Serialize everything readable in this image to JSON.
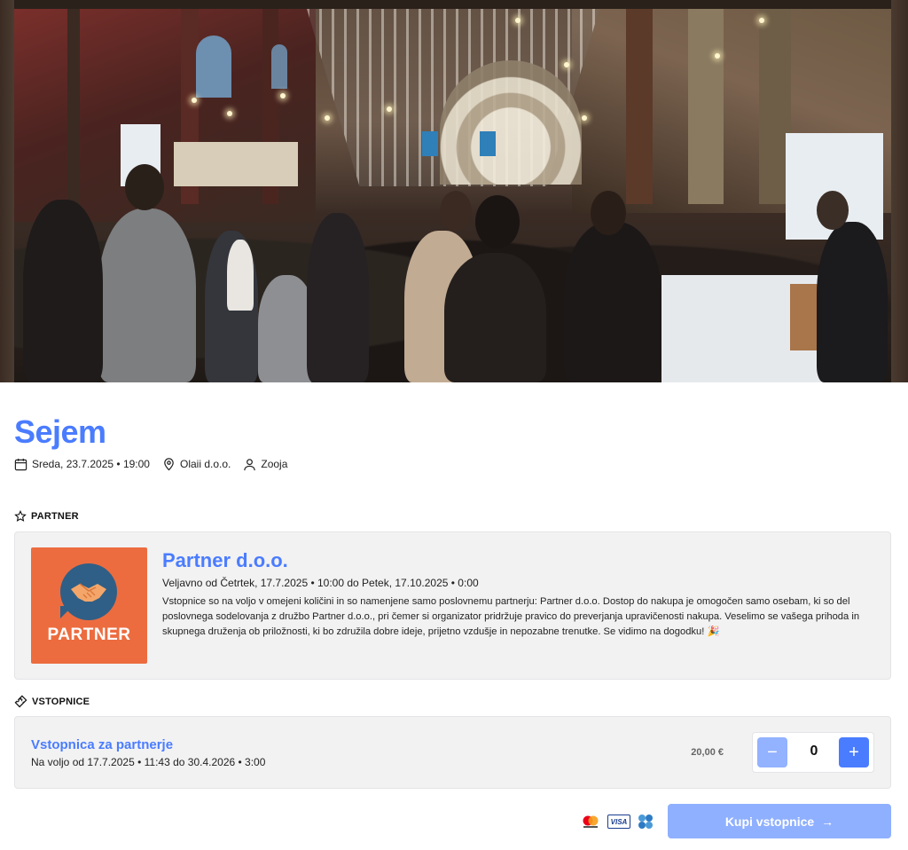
{
  "hero": {
    "image_icon": "trade-fair-hall-photo"
  },
  "event": {
    "title": "Sejem",
    "date": "Sreda, 23.7.2025 • 19:00",
    "venue": "Olaii d.o.o.",
    "organizer": "Zooja",
    "icons": {
      "date": "calendar-icon",
      "venue": "map-pin-icon",
      "organizer": "user-icon"
    }
  },
  "partner_section": {
    "label": "PARTNER",
    "icon": "star-icon",
    "logo_text": "PARTNER",
    "name": "Partner d.o.o.",
    "valid": "Veljavno od Četrtek, 17.7.2025 • 10:00 do Petek, 17.10.2025 • 0:00",
    "description": "Vstopnice so na voljo v omejeni količini in so namenjene samo poslovnemu partnerju: Partner d.o.o. Dostop do nakupa je omogočen samo osebam, ki so del poslovnega sodelovanja z družbo Partner d.o.o., pri čemer si organizator pridržuje pravico do preverjanja upravičenosti nakupa. Veselimo se vašega prihoda in skupnega druženja ob priložnosti, ki bo združila dobre ideje, prijetno vzdušje in nepozabne trenutke. Se vidimo na dogodku! 🎉"
  },
  "tickets_section": {
    "label": "VSTOPNICE",
    "icon": "ticket-icon",
    "tickets": [
      {
        "name": "Vstopnica za partnerje",
        "valid": "Na voljo od 17.7.2025 • 11:43 do 30.4.2026 • 3:00",
        "price": "20,00 €",
        "quantity": "0",
        "minus_label": "−",
        "plus_label": "+"
      }
    ]
  },
  "footer": {
    "payment_icons": [
      "mastercard-icon",
      "visa-icon",
      "wallet-icon"
    ],
    "visa_text": "VISA",
    "buy_label": "Kupi vstopnice",
    "buy_arrow": "→"
  },
  "colors": {
    "accent": "#4a7cff",
    "accent_light": "#8fb0ff",
    "card_bg": "#f2f2f3",
    "partner_logo_bg": "#ec6c3f"
  }
}
